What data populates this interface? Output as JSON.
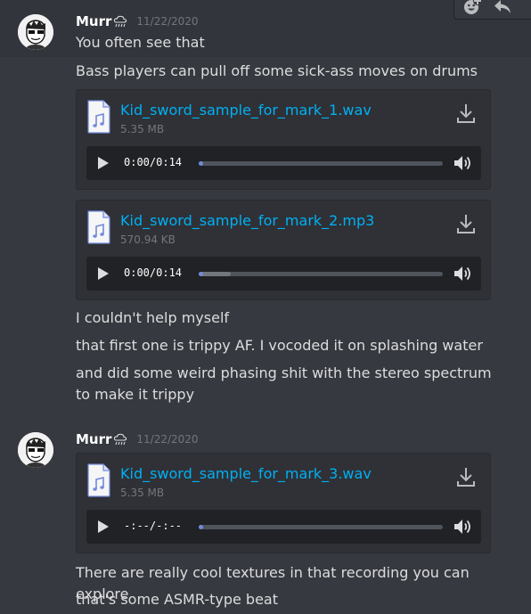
{
  "toolbar": {
    "icons": [
      "add-reaction-icon",
      "reply-icon"
    ]
  },
  "groups": [
    {
      "author": "Murr",
      "badge_icon": "cloud-rain-icon",
      "timestamp": "11/22/2020",
      "messages": [
        "You often see that",
        "Bass players can pull off some sick-ass moves on drums"
      ],
      "attachments": [
        {
          "filename": "Kid_sword_sample_for_mark_1.wav",
          "size": "5.35 MB",
          "time": "0:00/0:14",
          "progress": 0.0,
          "buffered": 0.0
        },
        {
          "filename": "Kid_sword_sample_for_mark_2.mp3",
          "size": "570.94 KB",
          "time": "0:00/0:14",
          "progress": 0.0,
          "buffered": 0.13
        }
      ],
      "after_messages": [
        "I couldn't help myself",
        "that first one is trippy AF. I vocoded it on splashing water",
        "and did some weird phasing shit with the stereo spectrum to make it trippy"
      ]
    },
    {
      "author": "Murr",
      "badge_icon": "cloud-rain-icon",
      "timestamp": "11/22/2020",
      "attachments": [
        {
          "filename": "Kid_sword_sample_for_mark_3.wav",
          "size": "5.35 MB",
          "time": "-:--/-:--",
          "progress": 0.0,
          "buffered": 0.0
        }
      ],
      "after_messages": [
        "There are really cool textures in that recording you can explore",
        "that's some ASMR-type beat"
      ]
    }
  ],
  "colors": {
    "background": "#36393f",
    "attachment_bg": "#2f3136",
    "player_bg": "#202225",
    "link": "#00b0f4",
    "progress": "#7289da"
  }
}
